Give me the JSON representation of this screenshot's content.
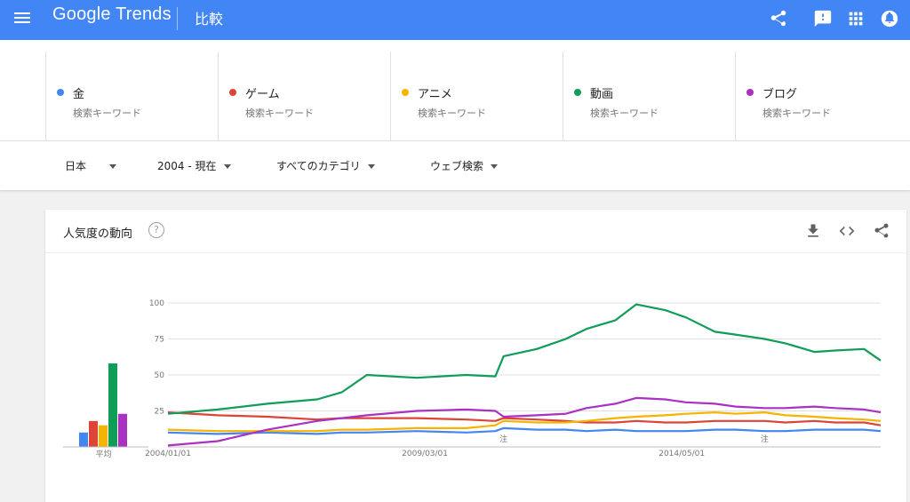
{
  "header": {
    "logo": "Google Trends",
    "page_title": "比較",
    "icons": [
      "menu-icon",
      "share-icon",
      "feedback-icon",
      "apps-icon",
      "notifications-icon"
    ]
  },
  "terms": [
    {
      "name": "金",
      "kind": "検索キーワード",
      "color": "#4285f4"
    },
    {
      "name": "ゲーム",
      "kind": "検索キーワード",
      "color": "#db4437"
    },
    {
      "name": "アニメ",
      "kind": "検索キーワード",
      "color": "#f4b400"
    },
    {
      "name": "動画",
      "kind": "検索キーワード",
      "color": "#0f9d58"
    },
    {
      "name": "ブログ",
      "kind": "検索キーワード",
      "color": "#ab30c4"
    }
  ],
  "filters": {
    "region": "日本",
    "period": "2004 - 現在",
    "category": "すべてのカテゴリ",
    "search_type": "ウェブ検索"
  },
  "card": {
    "title": "人気度の動向",
    "help_symbol": "?",
    "icons": [
      "download-icon",
      "embed-icon",
      "share-icon"
    ]
  },
  "chart_data": {
    "type": "line",
    "average_label": "平均",
    "note_label": "注",
    "notes_at": [
      "2010/10/01",
      "2016/01/01"
    ],
    "yticks": [
      25,
      50,
      75,
      100
    ],
    "ylim": [
      0,
      100
    ],
    "xtick_labels": [
      "2004/01/01",
      "2009/03/01",
      "2014/05/01"
    ],
    "xlim": [
      "2004/01/01",
      "2018/05/01"
    ],
    "averages": [
      {
        "name": "金",
        "value": 10
      },
      {
        "name": "ゲーム",
        "value": 18
      },
      {
        "name": "アニメ",
        "value": 15
      },
      {
        "name": "動画",
        "value": 58
      },
      {
        "name": "ブログ",
        "value": 23
      }
    ],
    "dates": [
      "2004/01",
      "2005/01",
      "2006/01",
      "2007/01",
      "2007/07",
      "2008/01",
      "2009/01",
      "2010/01",
      "2010/08",
      "2010/10",
      "2011/06",
      "2012/01",
      "2012/06",
      "2013/01",
      "2013/06",
      "2014/01",
      "2014/06",
      "2015/01",
      "2015/06",
      "2016/01",
      "2016/06",
      "2017/01",
      "2017/06",
      "2018/01",
      "2018/05"
    ],
    "series": [
      {
        "name": "金",
        "values": [
          10,
          9,
          10,
          9,
          10,
          10,
          11,
          10,
          11,
          13,
          12,
          12,
          11,
          12,
          11,
          11,
          11,
          12,
          12,
          11,
          11,
          12,
          12,
          12,
          11
        ]
      },
      {
        "name": "ゲーム",
        "values": [
          24,
          22,
          21,
          19,
          20,
          20,
          20,
          19,
          18,
          20,
          19,
          18,
          17,
          17,
          18,
          17,
          17,
          18,
          18,
          18,
          17,
          18,
          17,
          17,
          15
        ]
      },
      {
        "name": "アニメ",
        "values": [
          12,
          11,
          11,
          11,
          12,
          12,
          13,
          13,
          15,
          18,
          17,
          17,
          18,
          20,
          21,
          22,
          23,
          24,
          23,
          24,
          22,
          21,
          20,
          19,
          18
        ]
      },
      {
        "name": "動画",
        "values": [
          23,
          26,
          30,
          33,
          38,
          50,
          48,
          50,
          49,
          63,
          68,
          75,
          82,
          88,
          99,
          95,
          90,
          80,
          78,
          75,
          72,
          66,
          67,
          68,
          60
        ]
      },
      {
        "name": "ブログ",
        "values": [
          1,
          4,
          12,
          18,
          20,
          22,
          25,
          26,
          25,
          21,
          22,
          23,
          27,
          30,
          34,
          33,
          31,
          30,
          28,
          27,
          27,
          28,
          27,
          26,
          24
        ]
      }
    ]
  }
}
